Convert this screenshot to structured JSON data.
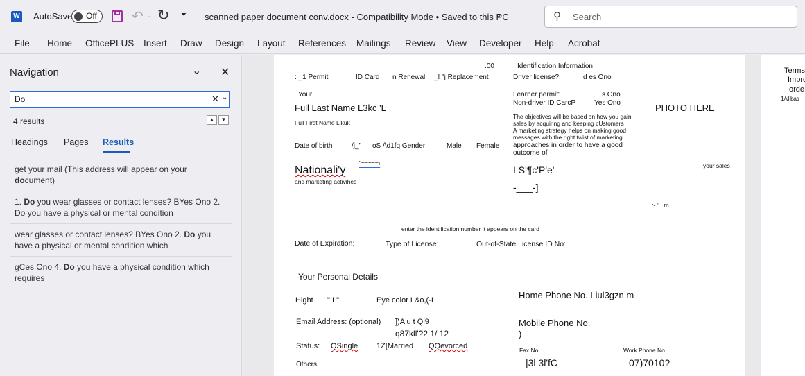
{
  "titlebar": {
    "autosave_label": "AutoSave",
    "autosave_state": "Off",
    "doc_title": "scanned paper document conv.docx  -  Compatibility Mode  •  Saved to this PC",
    "search_placeholder": "Search"
  },
  "ribbon": {
    "tabs": [
      "File",
      "Home",
      "OfficePLUS",
      "Insert",
      "Draw",
      "Design",
      "Layout",
      "References",
      "Mailings",
      "Review",
      "View",
      "Developer",
      "Help",
      "Acrobat"
    ]
  },
  "nav": {
    "title": "Navigation",
    "query": "Do",
    "count": "4 results",
    "tabs": [
      "Headings",
      "Pages",
      "Results"
    ],
    "active_tab": "Results",
    "results": [
      {
        "pre": "get your mail (This address will appear on your ",
        "hit": "do",
        "post": "cument)"
      },
      {
        "pre": "1. ",
        "hit": "Do",
        "post": " you wear glasses or contact lenses? BYes   Ono 2. Do you have a physical or mental condition"
      },
      {
        "pre": "wear glasses or contact lenses? BYes   Ono 2. ",
        "hit": "Do",
        "post": " you have a physical or mental condition which"
      },
      {
        "pre": "gCes   Ono 4. ",
        "hit": "Do",
        "post": " you have a physical condition which requires"
      }
    ]
  },
  "doc": {
    "t00": ".00",
    "t01": "Identification Information",
    "t02": ": _1 Permit",
    "t03": "ID Card",
    "t04": "n Renewal",
    "t05": "_! \"j Replacement",
    "t06": "Driver license?",
    "t07": "d es Ono",
    "t08": "Your",
    "t09": "Learner permit\"",
    "t10": "s Ono",
    "t11": "Full Last Name L3kc 'L",
    "t12": "Non-driver ID CarcP",
    "t13": "Yes Ono",
    "t14": "PHOTO HERE",
    "t15": "Full First Name Llkuk",
    "t16": "The objectives will be based on how you gain",
    "t17": "sales by acquiring and keeping cUstomers",
    "t18": "A marketing strategy helps on making good",
    "t19": "messages with the right twist of marketing",
    "t20": "Date of birth",
    "t21": "/j_\"",
    "t22": "oS /\\d1fq Gender",
    "t23": "Male",
    "t24": "Female",
    "t25": "approaches in order to have a good",
    "t26": "outcome of",
    "t27": "Nationali'y",
    "t28": "\"=====ı",
    "t29": "I S'¶c'P'e'",
    "t30": "your sales",
    "t31": "and marketing activihes",
    "t32": "-___-]",
    "t33": ":- '.. m",
    "t34": "enter the identification number it appears on the card",
    "t35": "Date of Expiration:",
    "t36": "Type of License:",
    "t37": "Out-of-State License ID No:",
    "t38": "Your Personal Details",
    "t39": "Home Phone No. Liul3gzn m",
    "t40": "Hight",
    "t41": "\" I \"",
    "t42": "Eye color L&o,(-I",
    "t43": "Email Address: (optional)",
    "t44": "])A u t Qi9",
    "t45": "q87kll'?2 1/ 12",
    "t46": "Mobile Phone No.",
    "t47": ")",
    "t48": "Status:",
    "t49": "QSingle",
    "t50": "1Z[Married",
    "t51": "QQevorced",
    "t52": "Fax No.",
    "t53": "Work Phone No.",
    "t54": "Others",
    "t55": "|3l 3l'fC",
    "t56": "07)7010?",
    "p2a": "Terms",
    "p2b": "Impro",
    "p2c": "orde",
    "p2d": "1All bas"
  }
}
